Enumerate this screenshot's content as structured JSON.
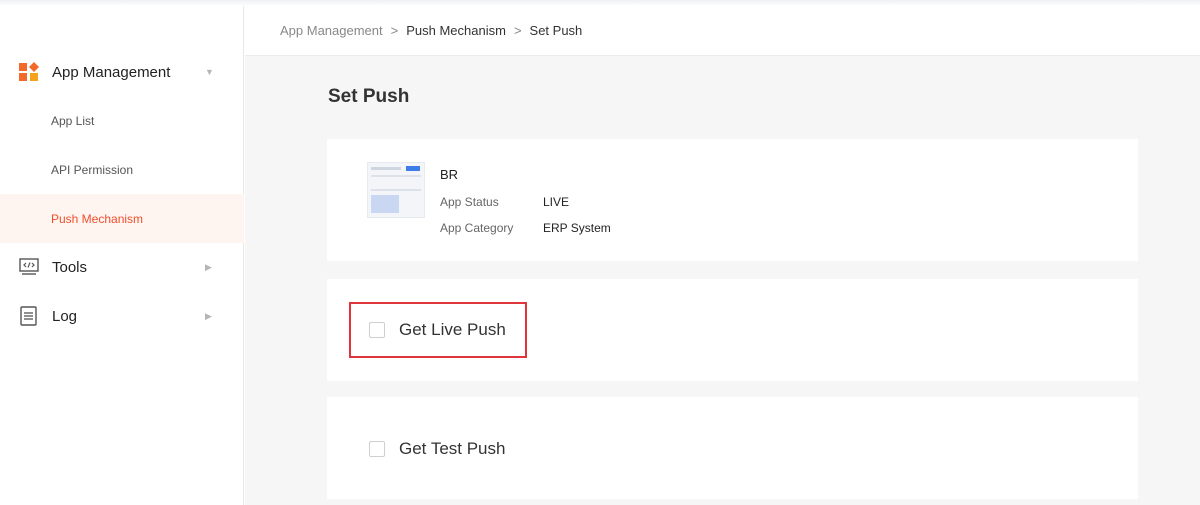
{
  "sidebar": {
    "groups": [
      {
        "label": "App Management",
        "icon": "app-grid-icon",
        "expanded": true
      },
      {
        "label": "Tools",
        "icon": "code-monitor-icon",
        "expanded": false
      },
      {
        "label": "Log",
        "icon": "document-icon",
        "expanded": false
      }
    ],
    "sub_items": [
      {
        "label": "App List",
        "active": false
      },
      {
        "label": "API Permission",
        "active": false
      },
      {
        "label": "Push Mechanism",
        "active": true
      }
    ]
  },
  "breadcrumb": {
    "items": [
      "App Management",
      "Push Mechanism",
      "Set Push"
    ],
    "separator": ">"
  },
  "page": {
    "title": "Set Push"
  },
  "app": {
    "name": "BR",
    "thumbnail": "app-screenshot-thumbnail",
    "status_label": "App Status",
    "status_value": "LIVE",
    "category_label": "App Category",
    "category_value": "ERP System"
  },
  "push_options": [
    {
      "label": "Get Live Push",
      "checked": false,
      "highlighted": true
    },
    {
      "label": "Get Test Push",
      "checked": false,
      "highlighted": false
    }
  ],
  "colors": {
    "accent": "#ee4d2d",
    "active_bg": "#fff5f0",
    "highlight_border": "#e0353a"
  }
}
